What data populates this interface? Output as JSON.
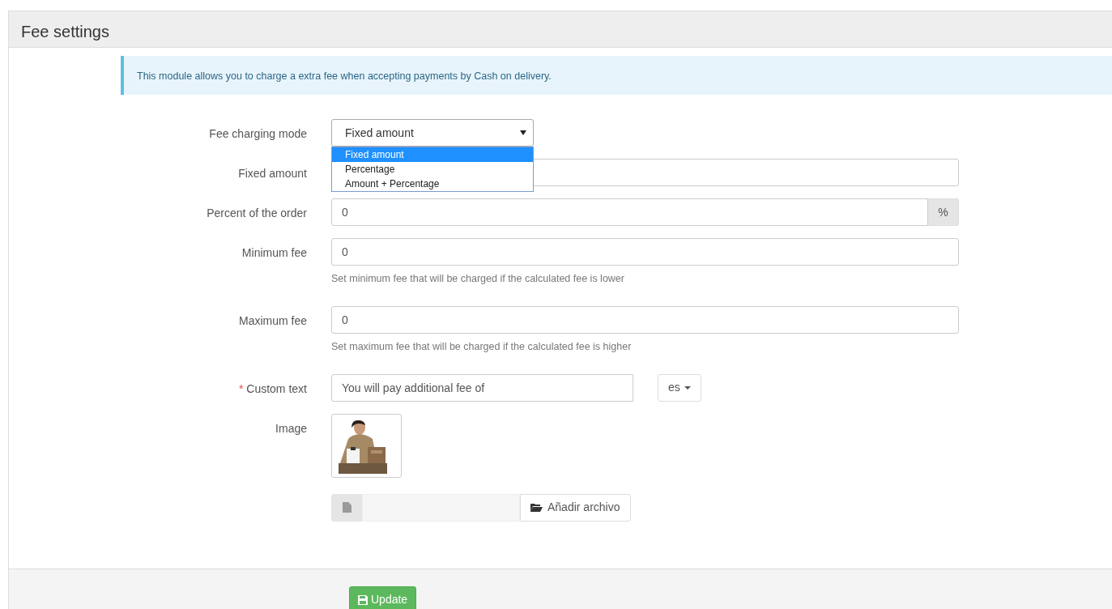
{
  "panel": {
    "title": "Fee settings"
  },
  "alert": "This module allows you to charge a extra fee when accepting payments by Cash on delivery.",
  "fields": [
    {
      "kind": "select",
      "label": "Fee charging mode",
      "value": "Fixed amount",
      "expanded": true,
      "options": [
        {
          "label": "Fixed amount",
          "selected": true
        },
        {
          "label": "Percentage",
          "selected": false
        },
        {
          "label": "Amount + Percentage",
          "selected": false
        }
      ]
    },
    {
      "kind": "text",
      "label": "Fixed amount"
    },
    {
      "kind": "addon",
      "label": "Percent of the order",
      "value": "0",
      "addon": "%"
    },
    {
      "kind": "text",
      "label": "Minimum fee",
      "value": "0",
      "help": "Set minimum fee that will be charged if the calculated fee is lower"
    },
    {
      "kind": "text",
      "label": "Maximum fee",
      "value": "0",
      "help": "Set maximum fee that will be charged if the calculated fee is higher"
    },
    {
      "kind": "translatable",
      "label": "Custom text",
      "required_mark": "*",
      "value": "You will pay additional fee of",
      "language": "es"
    },
    {
      "label": "Image",
      "file_button": "Añadir archivo"
    }
  ],
  "footer": {
    "button": "Update"
  }
}
